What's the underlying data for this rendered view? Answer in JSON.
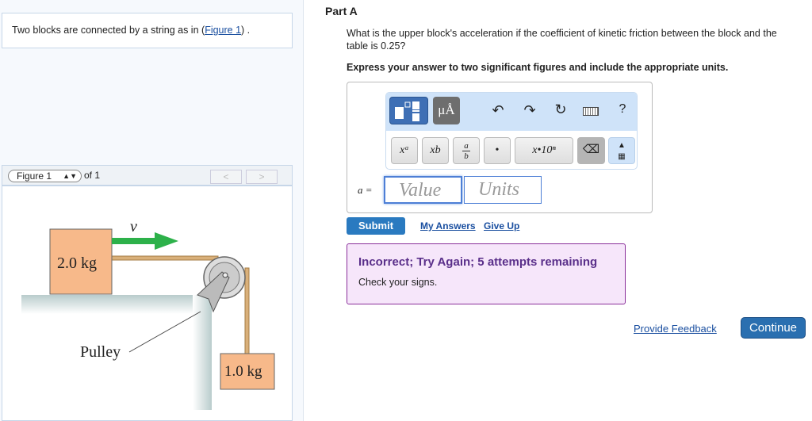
{
  "left": {
    "intro_text": "Two blocks are connected by a string as in (",
    "intro_link": "Figure 1",
    "intro_end": ") .",
    "figure_select": "Figure 1",
    "figure_of": "of 1",
    "prev": "<",
    "next": ">",
    "figure": {
      "upper_mass": "2.0 kg",
      "lower_mass": "1.0 kg",
      "velocity": "v⃗",
      "pulley_label": "Pulley"
    }
  },
  "part": {
    "title": "Part A",
    "question": "What is the upper block's acceleration if the coefficient of kinetic friction between the block and the table is 0.25?",
    "instruction": "Express your answer to two significant figures and include the appropriate units.",
    "toolbar": {
      "units_btn": "μÅ",
      "help": "?",
      "superscript": "xᵃ",
      "subscript": "xb",
      "fraction_a": "a",
      "fraction_b": "b",
      "dot": "•",
      "sci": "x•10ⁿ"
    },
    "answer_label": "a =",
    "value_placeholder": "Value",
    "units_placeholder": "Units",
    "submit": "Submit",
    "my_answers": "My Answers",
    "give_up": "Give Up",
    "feedback_title": "Incorrect; Try Again; 5 attempts remaining",
    "feedback_text": "Check your signs.",
    "provide_feedback": "Provide Feedback",
    "continue": "Continue"
  }
}
